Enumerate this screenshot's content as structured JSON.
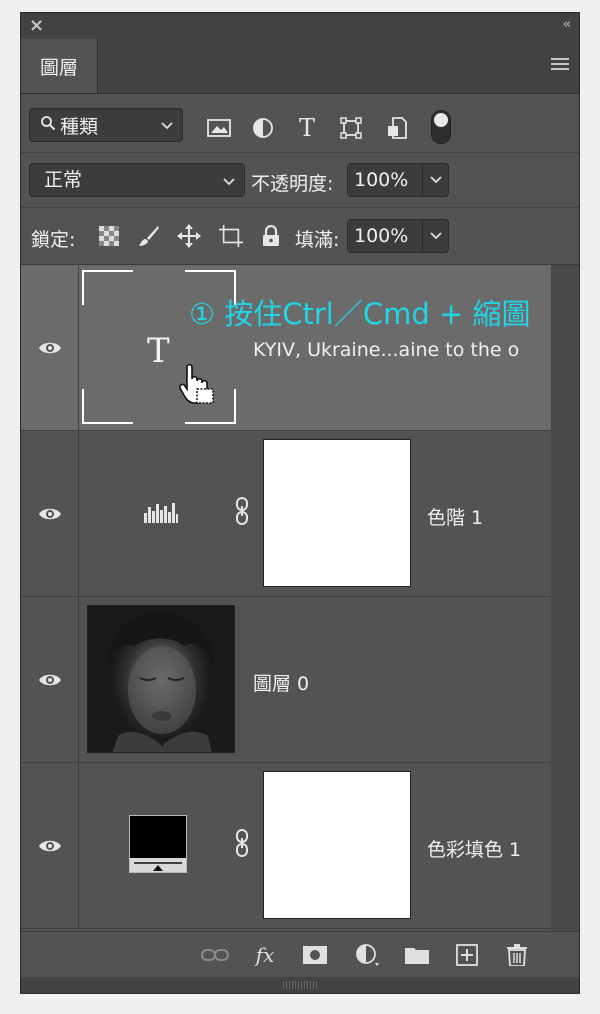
{
  "panel": {
    "tab_label": "圖層",
    "kind_filter": "種類",
    "blend_mode": "正常",
    "opacity_label": "不透明度:",
    "opacity_value": "100%",
    "lock_label": "鎖定:",
    "fill_label": "填滿:",
    "fill_value": "100%"
  },
  "icons": {
    "close": "×",
    "collapse": "‹‹",
    "search": "🔍︎",
    "chevron": "⌄",
    "type_filter": "T",
    "fx": "fx"
  },
  "layers": [
    {
      "name": "KYIV, Ukraine...aine to the o",
      "thumb_glyph": "T",
      "selected": true
    },
    {
      "name": "色階 1",
      "selected": false
    },
    {
      "name": "圖層 0",
      "selected": false
    },
    {
      "name": "色彩填色 1",
      "selected": false
    }
  ],
  "annotation": "① 按住Ctrl／Cmd + 縮圖",
  "colors": {
    "panel_bg": "#535353",
    "selected_row": "#6b6b6b",
    "annotation": "#1fd5e6"
  }
}
